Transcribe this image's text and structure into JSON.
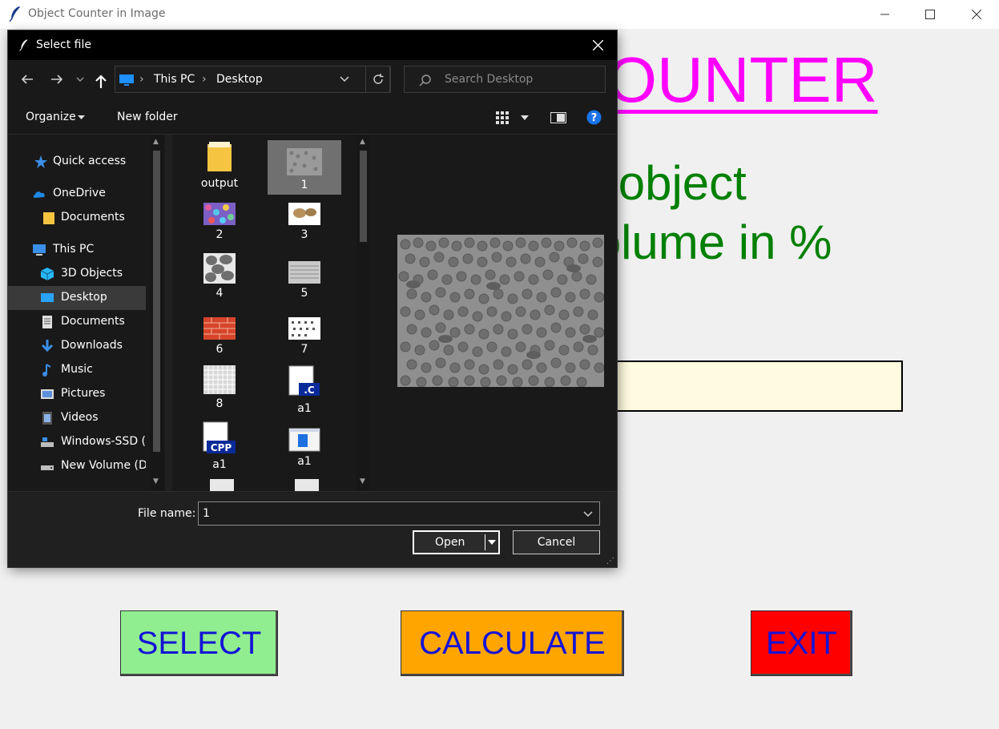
{
  "window": {
    "title": "Object Counter in Image",
    "controls": [
      "minimize",
      "maximize",
      "close"
    ]
  },
  "app": {
    "heading": "COUNTER",
    "line1": "th object",
    "line2": "Volume in %",
    "result_value": "",
    "buttons": {
      "select": "SELECT",
      "calculate": "CALCULATE",
      "exit": "EXIT"
    },
    "colors": {
      "heading": "#ff00ff",
      "body_text": "#008000",
      "select_bg": "#90ee90",
      "calculate_bg": "#ffa500",
      "exit_bg": "#ff0000",
      "button_text": "#1414d6",
      "result_box": "#fefbe0"
    }
  },
  "dialog": {
    "title": "Select file",
    "address": [
      "This PC",
      "Desktop"
    ],
    "search_placeholder": "Search Desktop",
    "commands": {
      "organize": "Organize",
      "new_folder": "New folder"
    },
    "nav_items": [
      {
        "label": "Quick access",
        "icon": "star-icon"
      },
      {
        "label": "OneDrive",
        "icon": "cloud-icon"
      },
      {
        "label": "Documents",
        "icon": "folder-icon"
      },
      {
        "label": "This PC",
        "icon": "computer-icon"
      },
      {
        "label": "3D Objects",
        "icon": "cube-icon"
      },
      {
        "label": "Desktop",
        "icon": "desktop-icon",
        "selected": true
      },
      {
        "label": "Documents",
        "icon": "document-icon"
      },
      {
        "label": "Downloads",
        "icon": "download-icon"
      },
      {
        "label": "Music",
        "icon": "music-icon"
      },
      {
        "label": "Pictures",
        "icon": "pictures-icon"
      },
      {
        "label": "Videos",
        "icon": "video-icon"
      },
      {
        "label": "Windows-SSD (C",
        "icon": "drive-icon"
      },
      {
        "label": "New Volume (D:",
        "icon": "drive-icon"
      }
    ],
    "files": [
      {
        "name": "output",
        "type": "folder"
      },
      {
        "name": "1",
        "type": "image",
        "selected": true
      },
      {
        "name": "2",
        "type": "image"
      },
      {
        "name": "3",
        "type": "image"
      },
      {
        "name": "4",
        "type": "image"
      },
      {
        "name": "5",
        "type": "image"
      },
      {
        "name": "6",
        "type": "image"
      },
      {
        "name": "7",
        "type": "image"
      },
      {
        "name": "8",
        "type": "image"
      },
      {
        "name": "a1",
        "type": "c-source"
      },
      {
        "name": "a1",
        "type": "cpp-source"
      },
      {
        "name": "a1",
        "type": "application"
      }
    ],
    "file_name_label": "File name:",
    "file_name_value": "1",
    "open_label": "Open",
    "cancel_label": "Cancel"
  }
}
